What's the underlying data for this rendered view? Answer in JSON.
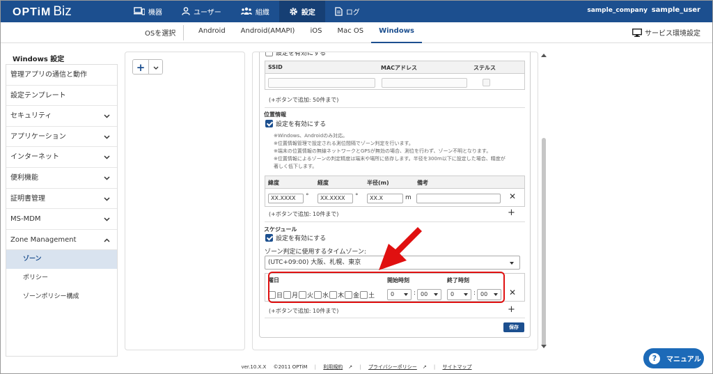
{
  "header": {
    "logo_main": "OPTiM",
    "logo_sub": "Biz",
    "nav": [
      {
        "label": "機器",
        "icon": "device-icon"
      },
      {
        "label": "ユーザー",
        "icon": "user-icon"
      },
      {
        "label": "組織",
        "icon": "organization-icon"
      },
      {
        "label": "設定",
        "icon": "gear-icon"
      },
      {
        "label": "ログ",
        "icon": "log-icon"
      }
    ],
    "company": "sample_company",
    "user": "sample_user"
  },
  "os_row": {
    "select_label": "OSを選択",
    "tabs": [
      "Android",
      "Android(AMAPI)",
      "iOS",
      "Mac OS",
      "Windows"
    ],
    "active_tab": "Windows",
    "service_settings": "サービス環境設定"
  },
  "sidebar": {
    "title": "Windows 設定",
    "items": [
      {
        "label": "管理アプリの通信と動作"
      },
      {
        "label": "設定テンプレート"
      },
      {
        "label": "セキュリティ"
      },
      {
        "label": "アプリケーション"
      },
      {
        "label": "インターネット"
      },
      {
        "label": "便利機能"
      },
      {
        "label": "証明書管理"
      },
      {
        "label": "MS-MDM"
      },
      {
        "label": "Zone Management"
      }
    ],
    "sub_items": [
      "ゾーン",
      "ポリシー",
      "ゾーンポリシー構成"
    ],
    "active_sub": "ゾーン"
  },
  "form": {
    "top_cut_label": "設定を有効にする",
    "wifi_table": {
      "headers": [
        "SSID",
        "MACアドレス",
        "ステルス"
      ],
      "hint": "(+ボタンで追加: 50件まで)"
    },
    "location": {
      "section": "位置情報",
      "enable_label": "設定を有効にする",
      "notes": [
        "※Windows、Androidのみ対応。",
        "※位置情報管理で設定される測位間隔でゾーン判定を行います。",
        "※端末の位置情報の無線ネットワークとGPSが無効の場合、測位を行わず、ゾーン不明となります。",
        "※位置情報によるゾーンの判定精度は端末や場所に依存します。半径を300m以下に設定した場合、精度が",
        "著しく低下します。"
      ],
      "headers": [
        "緯度",
        "経度",
        "半径(m)",
        "備考"
      ],
      "lat_value": "XX.XXXX",
      "lon_value": "XX.XXXX",
      "radius_value": "XX.X",
      "degree_unit": "°",
      "meter_unit": "m",
      "hint": "(+ボタンで追加: 10件まで)"
    },
    "schedule": {
      "section": "スケジュール",
      "enable_label": "設定を有効にする",
      "timezone_label": "ゾーン判定に使用するタイムゾーン:",
      "timezone_value": "(UTC+09:00) 大阪、札幌、東京",
      "headers": [
        "曜日",
        "開始時刻",
        "終了時刻"
      ],
      "days": [
        "日",
        "月",
        "火",
        "水",
        "木",
        "金",
        "土"
      ],
      "start_hour": "0",
      "start_min": "00",
      "end_hour": "0",
      "end_min": "00",
      "colon": ":",
      "hint": "(+ボタンで追加: 10件まで)"
    },
    "save_label": "保存"
  },
  "footer": {
    "version": "ver.10.X.X",
    "copyright": "©2011 OPTiM",
    "terms": "利用規約",
    "privacy": "プライバシーポリシー",
    "sitemap": "サイトマップ"
  },
  "manual_label": "マニュアル",
  "colors": {
    "brand": "#1c4f8f",
    "highlight": "#e01010",
    "manual": "#1c6ab8"
  }
}
